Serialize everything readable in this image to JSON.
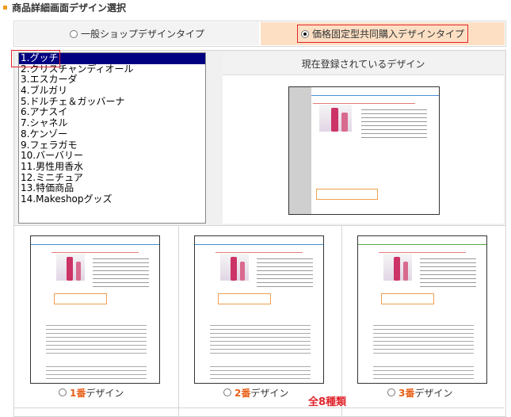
{
  "heading": "商品詳細画面デザイン選択",
  "type_options": [
    {
      "label": "一般ショップデザインタイプ",
      "selected": false
    },
    {
      "label": "価格固定型共同購入デザインタイプ",
      "selected": true
    }
  ],
  "list_items": [
    "1.グッチ",
    "2.クリスチャンディオール",
    "3.エスカーダ",
    "4.ブルガリ",
    "5.ドルチェ＆ガッバーナ",
    "6.アナスイ",
    "7.シャネル",
    "8.ケンゾー",
    "9.フェラガモ",
    "10.バーバリー",
    "11.男性用香水",
    "12.ミニチュア",
    "13.特価商品",
    "14.Makeshopグッズ"
  ],
  "selected_index": 0,
  "current_design_title": "現在登録されているデザイン",
  "designs": [
    {
      "num": "1番",
      "suffix": "デザイン"
    },
    {
      "num": "2番",
      "suffix": "デザイン"
    },
    {
      "num": "3番",
      "suffix": "デザイン"
    }
  ],
  "total_label": "全8種類",
  "colors": {
    "accent": "#f29a1f",
    "selected_bg": "#fde0c4",
    "highlight_red": "#e0242b",
    "list_sel": "#000080",
    "design_num": "#e8601a"
  }
}
